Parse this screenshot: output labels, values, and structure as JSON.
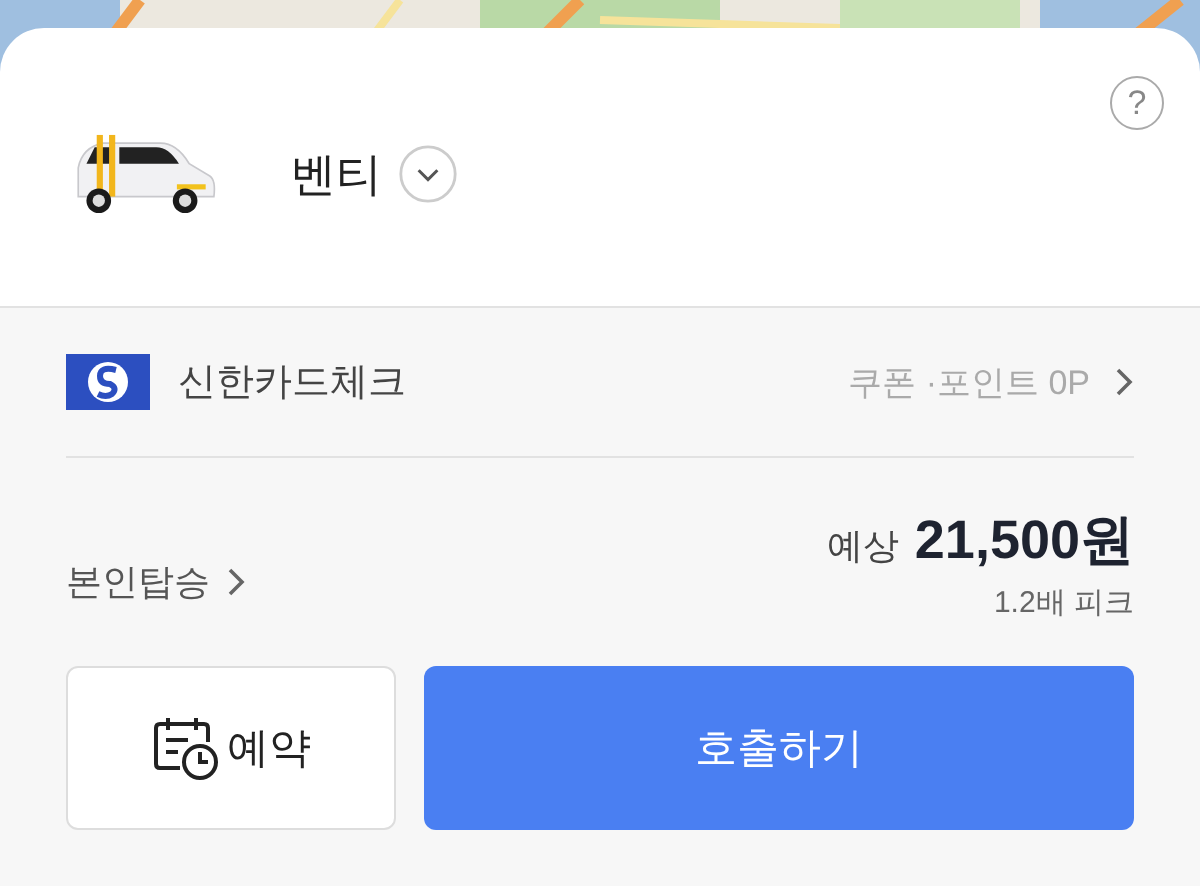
{
  "help": "?",
  "vehicle": {
    "name": "벤티",
    "expanded": false
  },
  "payment": {
    "card": "신한카드체크",
    "discount": "쿠폰 ·포인트 0P"
  },
  "rider": "본인탑승",
  "fare": {
    "label": "예상",
    "amount": "21,500원",
    "surge": "1.2배 피크"
  },
  "buttons": [
    {
      "kind": "reserve",
      "label": "예약"
    },
    {
      "kind": "call",
      "label": "호출하기"
    }
  ]
}
